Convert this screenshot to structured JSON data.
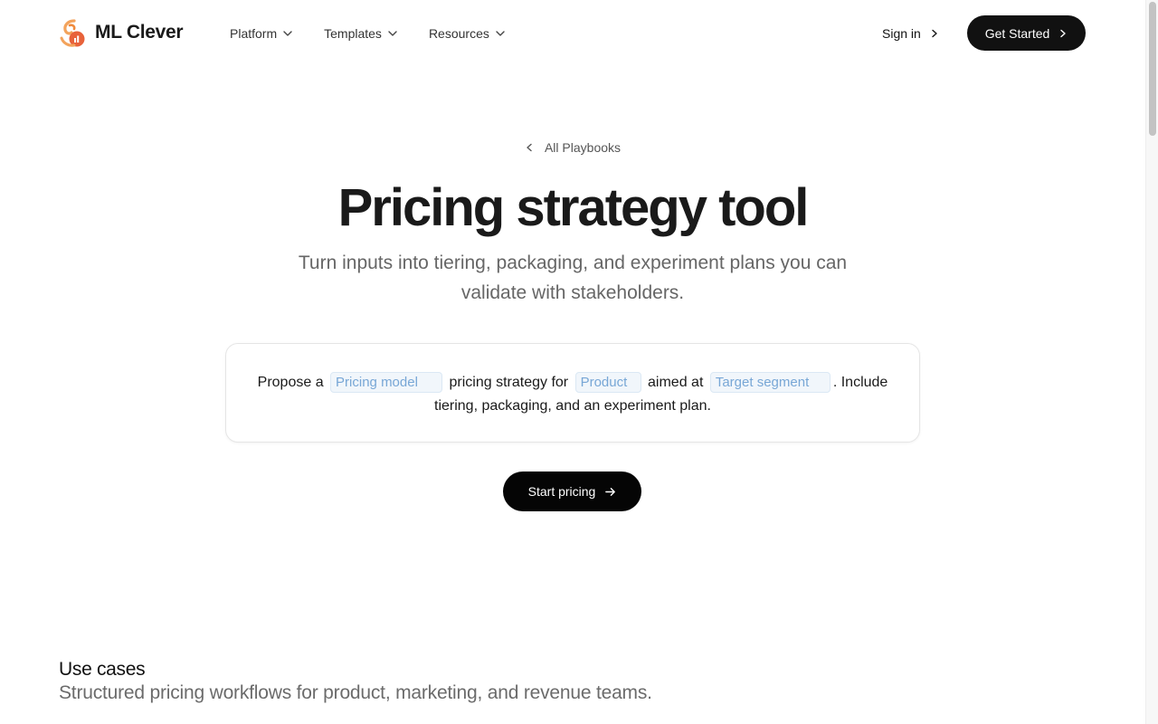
{
  "brand": {
    "name": "ML Clever",
    "colors": {
      "logo_primary": "#f08a3c",
      "logo_secondary": "#e0502f",
      "dark": "#111111",
      "chip_text": "#78a7d6"
    }
  },
  "nav": {
    "items": [
      {
        "label": "Platform",
        "icon": "chevron-down-icon"
      },
      {
        "label": "Templates",
        "icon": "chevron-down-icon"
      },
      {
        "label": "Resources",
        "icon": "chevron-down-icon"
      }
    ],
    "signin_label": "Sign in",
    "cta_label": "Get Started"
  },
  "hero": {
    "back_label": "All Playbooks",
    "title": "Pricing strategy tool",
    "subtitle": "Turn inputs into tiering, packaging, and experiment plans you can validate with stakeholders."
  },
  "prompt": {
    "part1": "Propose a",
    "part2": "pricing strategy for",
    "part3": "aimed at",
    "part4": ". Include tiering, packaging, and an experiment plan.",
    "fields": {
      "pricing_model": {
        "placeholder": "Pricing model",
        "value": ""
      },
      "product": {
        "placeholder": "Product",
        "value": ""
      },
      "target_segment": {
        "placeholder": "Target segment",
        "value": ""
      }
    }
  },
  "start_button_label": "Start pricing",
  "use_cases": {
    "title": "Use cases",
    "subtitle": "Structured pricing workflows for product, marketing, and revenue teams."
  }
}
